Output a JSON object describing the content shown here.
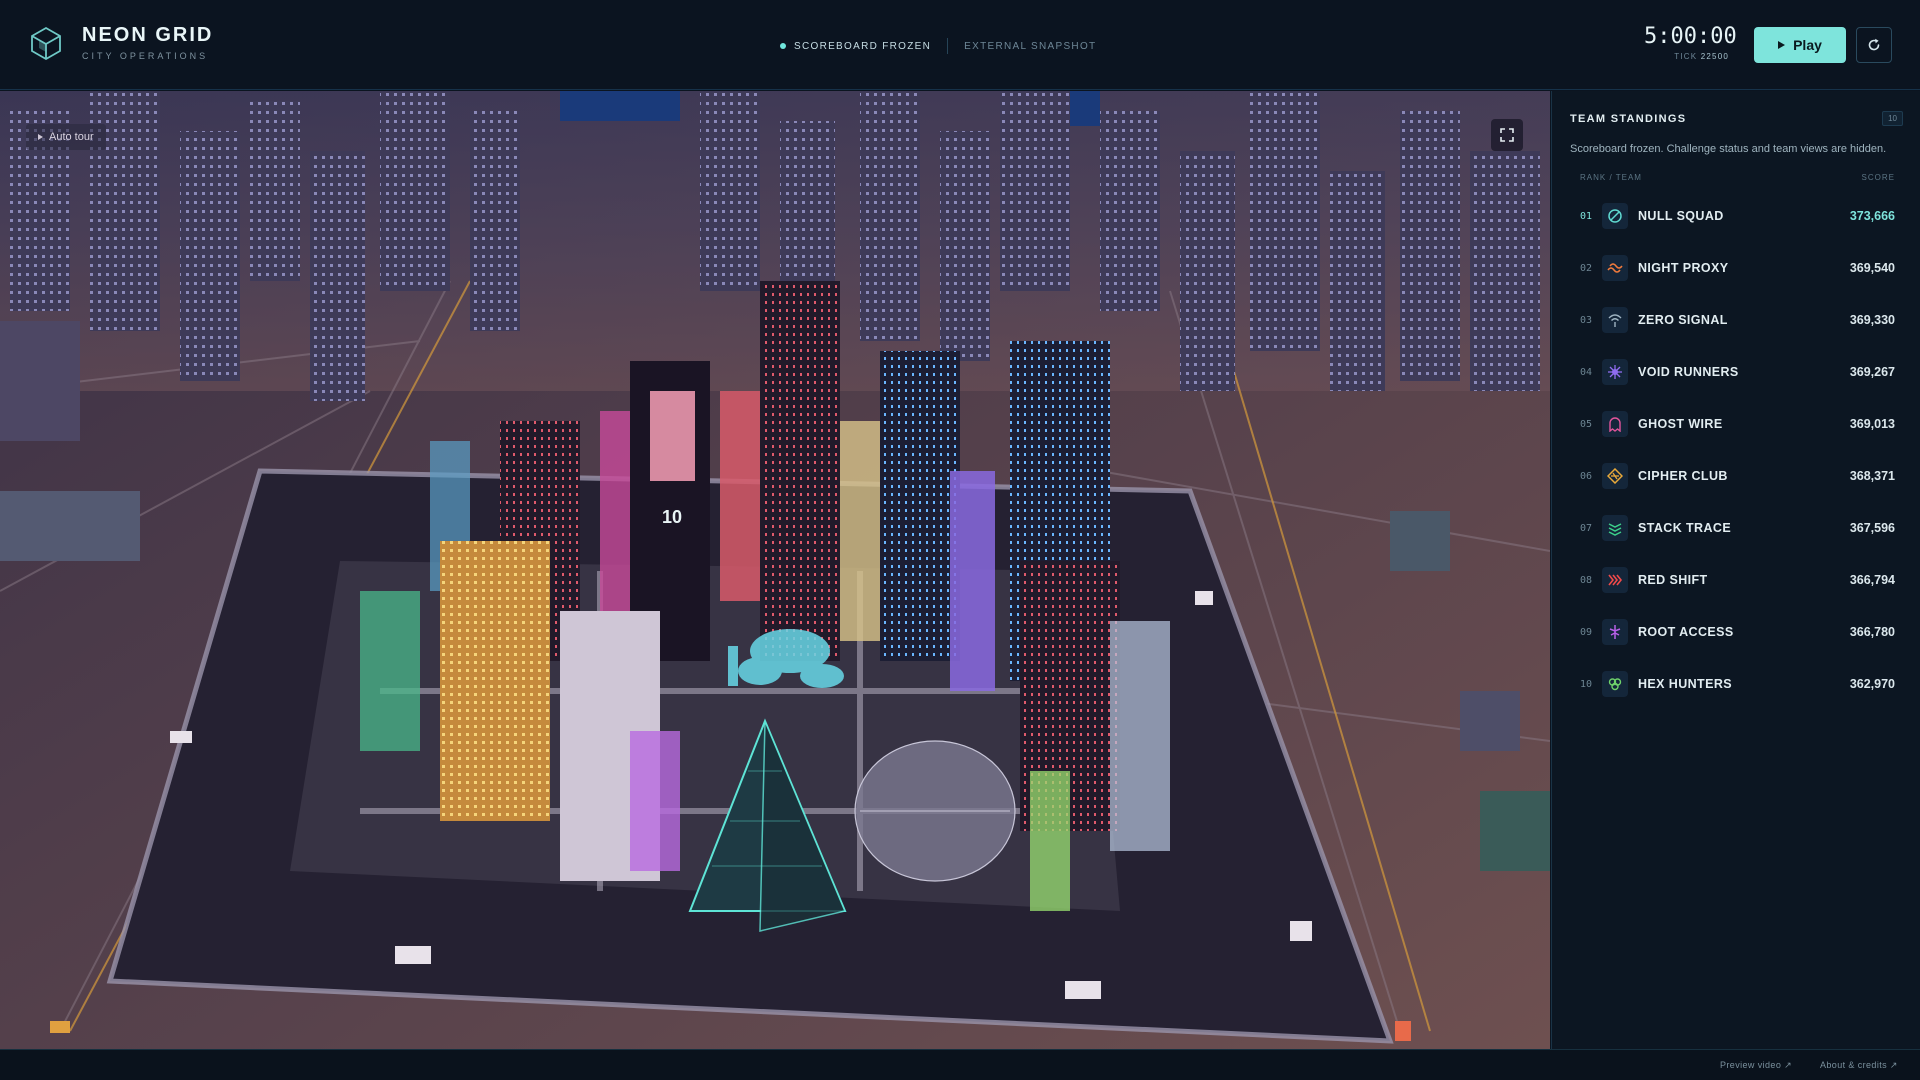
{
  "brand": {
    "title": "NEON GRID",
    "subtitle": "CITY OPERATIONS"
  },
  "status": {
    "frozen": "SCOREBOARD FROZEN",
    "snapshot": "EXTERNAL SNAPSHOT"
  },
  "timer": {
    "clock": "5:00:00",
    "tick_label": "TICK",
    "tick_value": "22500"
  },
  "controls": {
    "play_label": "Play",
    "reset_icon": "reset-icon"
  },
  "viewport": {
    "autotour_label": "Auto tour",
    "billboard_number": "10",
    "fullscreen_icon": "fullscreen-icon"
  },
  "standings": {
    "title": "TEAM STANDINGS",
    "count": "10",
    "note": "Scoreboard frozen. Challenge status and team views are hidden.",
    "col_rank_team": "RANK / TEAM",
    "col_score": "SCORE",
    "teams": [
      {
        "rank": "01",
        "name": "NULL SQUAD",
        "score": "373,666",
        "icon": "null-icon",
        "color": "#5fd9d0"
      },
      {
        "rank": "02",
        "name": "NIGHT PROXY",
        "score": "369,540",
        "icon": "proxy-icon",
        "color": "#f07a3c"
      },
      {
        "rank": "03",
        "name": "ZERO SIGNAL",
        "score": "369,330",
        "icon": "signal-icon",
        "color": "#9fb4c2"
      },
      {
        "rank": "04",
        "name": "VOID RUNNERS",
        "score": "369,267",
        "icon": "void-icon",
        "color": "#8f6cf0"
      },
      {
        "rank": "05",
        "name": "GHOST WIRE",
        "score": "369,013",
        "icon": "ghost-icon",
        "color": "#e2559b"
      },
      {
        "rank": "06",
        "name": "CIPHER CLUB",
        "score": "368,371",
        "icon": "cipher-icon",
        "color": "#e8a93a"
      },
      {
        "rank": "07",
        "name": "STACK TRACE",
        "score": "367,596",
        "icon": "stack-icon",
        "color": "#3ccf8a"
      },
      {
        "rank": "08",
        "name": "RED SHIFT",
        "score": "366,794",
        "icon": "shift-icon",
        "color": "#f04a4a"
      },
      {
        "rank": "09",
        "name": "ROOT ACCESS",
        "score": "366,780",
        "icon": "root-icon",
        "color": "#b860e8"
      },
      {
        "rank": "10",
        "name": "HEX HUNTERS",
        "score": "362,970",
        "icon": "hex-icon",
        "color": "#6fd26b"
      }
    ]
  },
  "footer": {
    "preview": "Preview video ↗",
    "about": "About & credits ↗"
  },
  "colors": {
    "accent": "#7ee4dc",
    "background": "#0b1420"
  }
}
